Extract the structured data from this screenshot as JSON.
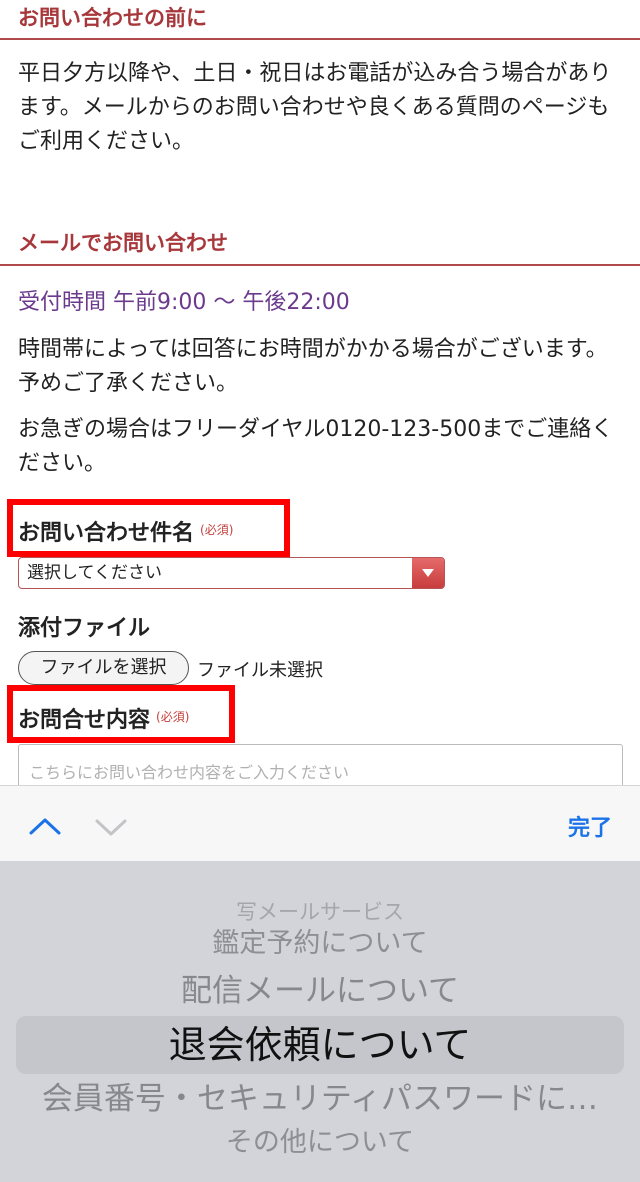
{
  "before_inquiry": {
    "heading": "お問い合わせの前に",
    "body": "平日夕方以降や、土日・祝日はお電話が込み合う場合があります。メールからのお問い合わせや良くある質問のページもご利用ください。"
  },
  "mail_inquiry": {
    "heading": "メールでお問い合わせ",
    "hours": "受付時間 午前9:00 ～ 午後22:00",
    "note1": "時間帯によっては回答にお時間がかかる場合がございます。予めご了承ください。",
    "note2": "お急ぎの場合はフリーダイヤル0120-123-500までご連絡ください。"
  },
  "form": {
    "subject_label": "お問い合わせ件名",
    "subject_required": "(必須)",
    "subject_select_value": "選択してください",
    "attachment_label": "添付ファイル",
    "file_button": "ファイルを選択",
    "file_status": "ファイル未選択",
    "content_label": "お問合せ内容",
    "content_required": "(必須)",
    "content_placeholder": "こちらにお問い合わせ内容をご入力ください"
  },
  "keyboard": {
    "done_label": "完了",
    "prev_icon": "chevron-up-icon",
    "next_icon": "chevron-down-icon"
  },
  "picker": {
    "items": [
      "写メールサービス",
      "鑑定予約について",
      "配信メールについて",
      "退会依頼について",
      "会員番号・セキュリティパスワードに…",
      "その他について"
    ],
    "selected_index": 3
  },
  "colors": {
    "accent": "#a8373b",
    "hours_text": "#6b3a8c",
    "highlight_box": "#ff0000",
    "ios_blue": "#1a73e8"
  }
}
